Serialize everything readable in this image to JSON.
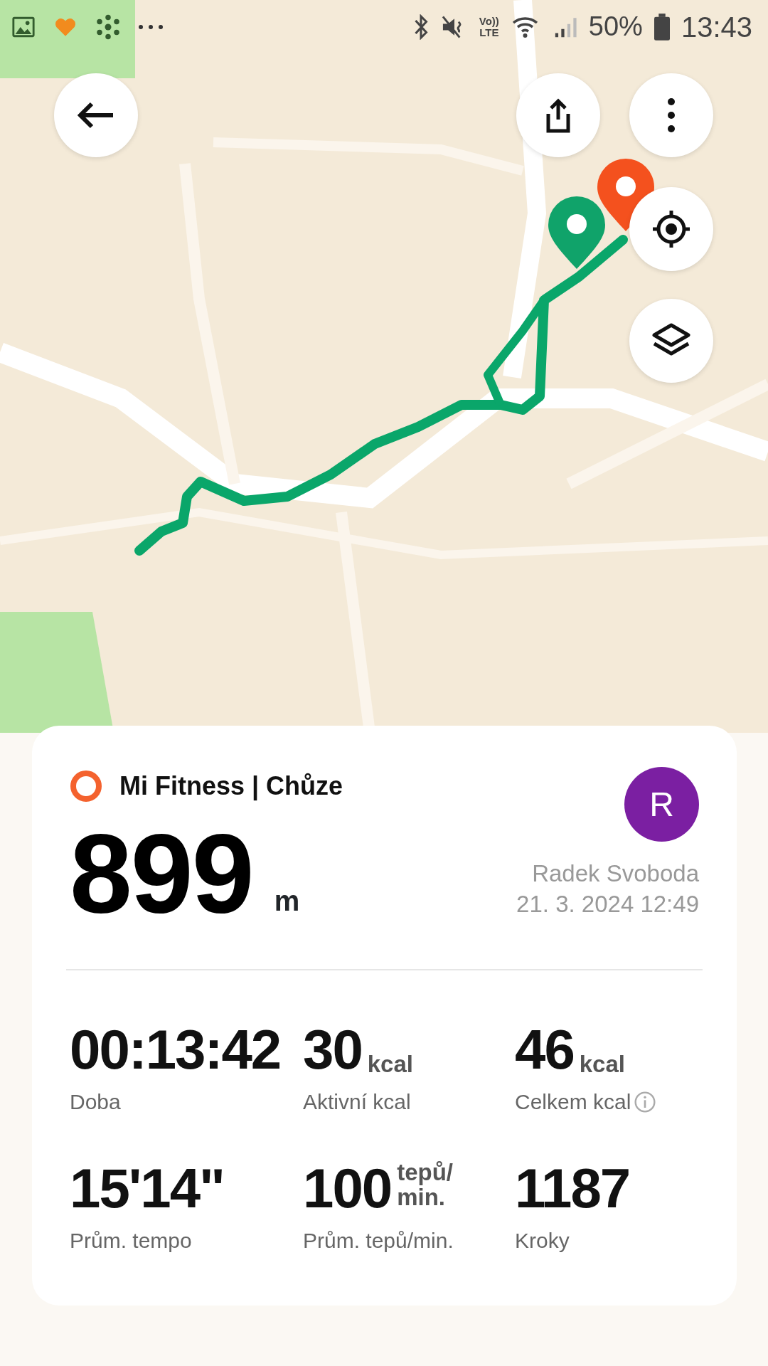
{
  "status_bar": {
    "network": [
      "Vo))",
      "LTE"
    ],
    "battery": "50%",
    "time": "13:43"
  },
  "activity": {
    "title": "Mi Fitness | Chůze",
    "distance": "899",
    "distance_unit": "m",
    "avatar_letter": "R",
    "user": "Radek Svoboda",
    "date": "21. 3. 2024 12:49"
  },
  "stats": [
    {
      "value": "00:13:42",
      "label": "Doba"
    },
    {
      "value": "30",
      "unit": "kcal",
      "label": "Aktivní kcal"
    },
    {
      "value": "46",
      "unit": "kcal",
      "label": "Celkem kcal",
      "info": true
    },
    {
      "value": "15'14\"",
      "label": "Prům. tempo"
    },
    {
      "value": "100",
      "unit": "tepů/ min.",
      "label": "Prům. tepů/min."
    },
    {
      "value": "1187",
      "label": "Kroky"
    }
  ]
}
